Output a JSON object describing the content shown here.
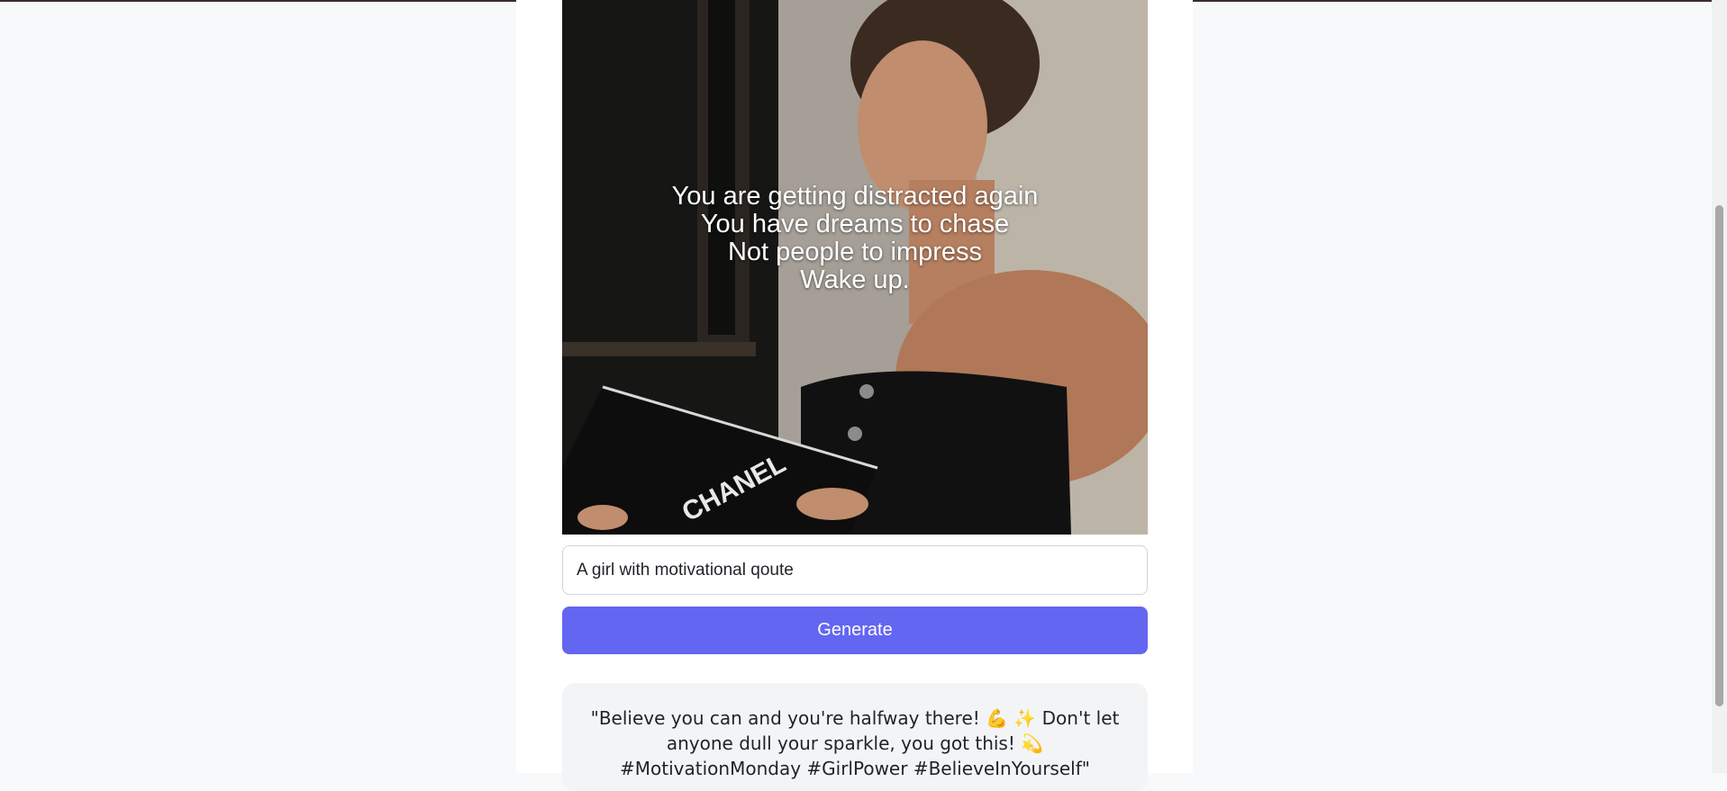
{
  "image": {
    "quote_lines": [
      "You are getting distracted again",
      "You have dreams to chase",
      "Not people to impress",
      "Wake up."
    ],
    "book_text": "CHANEL"
  },
  "prompt": {
    "value": "A girl with motivational qoute"
  },
  "generate_label": "Generate",
  "caption": "\"Believe you can and you're halfway there! 💪 ✨ Don't let anyone dull your sparkle, you got this! 💫 #MotivationMonday #GirlPower #BelieveInYourself\"",
  "colors": {
    "accent": "#6366f1",
    "page_background": "#f8f9fb",
    "caption_background": "#f3f4f6"
  }
}
